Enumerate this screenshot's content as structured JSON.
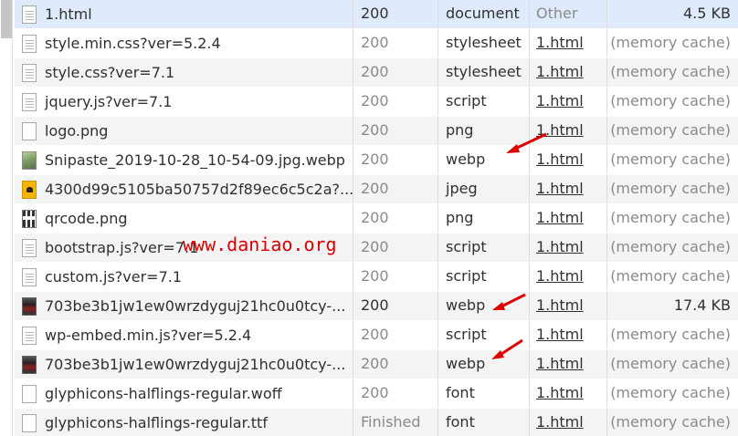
{
  "watermark": "www.daniao.org",
  "rows": [
    {
      "name": "1.html",
      "status": "200",
      "type": "document",
      "initiator": "Other",
      "size": "4.5 KB"
    },
    {
      "name": "style.min.css?ver=5.2.4",
      "status": "200",
      "type": "stylesheet",
      "initiator": "1.html",
      "size": "(memory cache)"
    },
    {
      "name": "style.css?ver=7.1",
      "status": "200",
      "type": "stylesheet",
      "initiator": "1.html",
      "size": "(memory cache)"
    },
    {
      "name": "jquery.js?ver=7.1",
      "status": "200",
      "type": "script",
      "initiator": "1.html",
      "size": "(memory cache)"
    },
    {
      "name": "logo.png",
      "status": "200",
      "type": "png",
      "initiator": "1.html",
      "size": "(memory cache)"
    },
    {
      "name": "Snipaste_2019-10-28_10-54-09.jpg.webp",
      "status": "200",
      "type": "webp",
      "initiator": "1.html",
      "size": "(memory cache)"
    },
    {
      "name": "4300d99c5105ba50757d2f89ec6c5c2a?...",
      "status": "200",
      "type": "jpeg",
      "initiator": "1.html",
      "size": "(memory cache)"
    },
    {
      "name": "qrcode.png",
      "status": "200",
      "type": "png",
      "initiator": "1.html",
      "size": "(memory cache)"
    },
    {
      "name": "bootstrap.js?ver=7.1",
      "status": "200",
      "type": "script",
      "initiator": "1.html",
      "size": "(memory cache)"
    },
    {
      "name": "custom.js?ver=7.1",
      "status": "200",
      "type": "script",
      "initiator": "1.html",
      "size": "(memory cache)"
    },
    {
      "name": "703be3b1jw1ew0wrzdyguj21hc0u0tcy-...",
      "status": "200",
      "type": "webp",
      "initiator": "1.html",
      "size": "17.4 KB"
    },
    {
      "name": "wp-embed.min.js?ver=5.2.4",
      "status": "200",
      "type": "script",
      "initiator": "1.html",
      "size": "(memory cache)"
    },
    {
      "name": "703be3b1jw1ew0wrzdyguj21hc0u0tcy-...",
      "status": "200",
      "type": "webp",
      "initiator": "1.html",
      "size": "(memory cache)"
    },
    {
      "name": "glyphicons-halflings-regular.woff",
      "status": "200",
      "type": "font",
      "initiator": "1.html",
      "size": "(memory cache)"
    },
    {
      "name": "glyphicons-halflings-regular.ttf",
      "status": "Finished",
      "type": "font",
      "initiator": "1.html",
      "size": "(memory cache)"
    }
  ]
}
